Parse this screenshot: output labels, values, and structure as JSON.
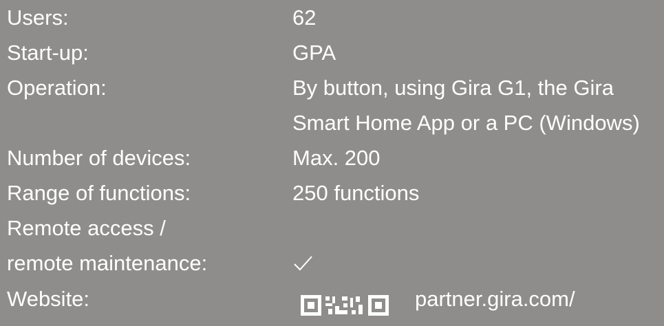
{
  "specs": {
    "rows": [
      {
        "label": "Users:",
        "value": "62"
      },
      {
        "label": "Start-up:",
        "value": "GPA"
      },
      {
        "label": "Operation:",
        "value_lines": [
          "By button, using Gira G1, the Gira",
          "Smart Home App or a PC (Windows)"
        ]
      },
      {
        "label": "Number of devices:",
        "value": "Max. 200"
      },
      {
        "label": "Range of functions:",
        "value": "250 functions"
      },
      {
        "label_lines": [
          "Remote access /",
          "remote maintenance:"
        ],
        "value": "✓",
        "icon": "checkmark-icon"
      },
      {
        "label": "Website:",
        "value": "partner.gira.com/",
        "icon": "qr-code-icon"
      }
    ]
  },
  "colors": {
    "background": "#8e8d8c",
    "text": "#ffffff"
  }
}
